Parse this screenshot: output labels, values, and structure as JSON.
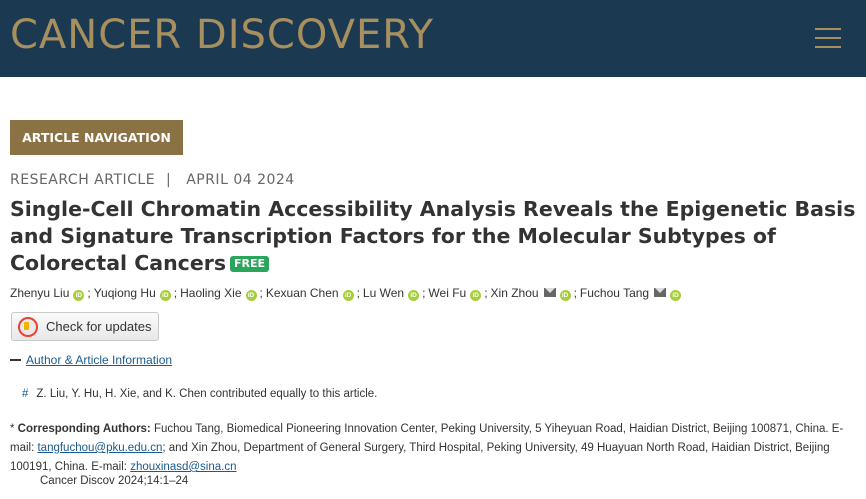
{
  "header": {
    "brand": "CANCER DISCOVERY",
    "menu_icon": "hamburger-menu-icon"
  },
  "article_nav_label": "ARTICLE NAVIGATION",
  "meta": {
    "type": "RESEARCH ARTICLE",
    "separator": "|",
    "date": "APRIL 04 2024"
  },
  "title": "Single-Cell Chromatin Accessibility Analysis Reveals the Epigenetic Basis and Signature Transcription Factors for the Molecular Subtypes of Colorectal Cancers",
  "free_badge": "FREE",
  "authors": [
    {
      "name": "Zhenyu Liu"
    },
    {
      "name": "Yuqiong Hu"
    },
    {
      "name": "Haoling Xie"
    },
    {
      "name": "Kexuan Chen"
    },
    {
      "name": "Lu Wen"
    },
    {
      "name": "Wei Fu"
    },
    {
      "name": "Xin Zhou"
    },
    {
      "name": "Fuchou Tang"
    }
  ],
  "author_separator": ";",
  "orcid_glyph": "iD",
  "check_updates_label": "Check for updates",
  "author_info_link": "Author & Article Information",
  "footnote": {
    "marker": "#",
    "text": "Z. Liu, Y. Hu, H. Xie, and K. Chen contributed equally to this article."
  },
  "corresponding": {
    "prefix": "* ",
    "label": "Corresponding Authors:",
    "text1": " Fuchou Tang, Biomedical Pioneering Innovation Center, Peking University, 5 Yiheyuan Road, Haidian District, Beijing 100871, China. E-mail: ",
    "email1": "tangfuchou@pku.edu.cn",
    "text2": "; and Xin Zhou, Department of General Surgery, Third Hospital, Peking University, 49 Huayuan North Road, Haidian District, Beijing 100191, China. E-mail: ",
    "email2": "zhouxinasd@sina.cn"
  },
  "citation": "Cancer Discov 2024;14:1–24",
  "colors": {
    "header_bg": "#1b3a52",
    "brand_gold": "#a88f5e",
    "nav_button_bg": "#8b7245",
    "free_green": "#2aa65c",
    "orcid_green": "#a6ce39",
    "link_blue": "#1a5a8e"
  }
}
